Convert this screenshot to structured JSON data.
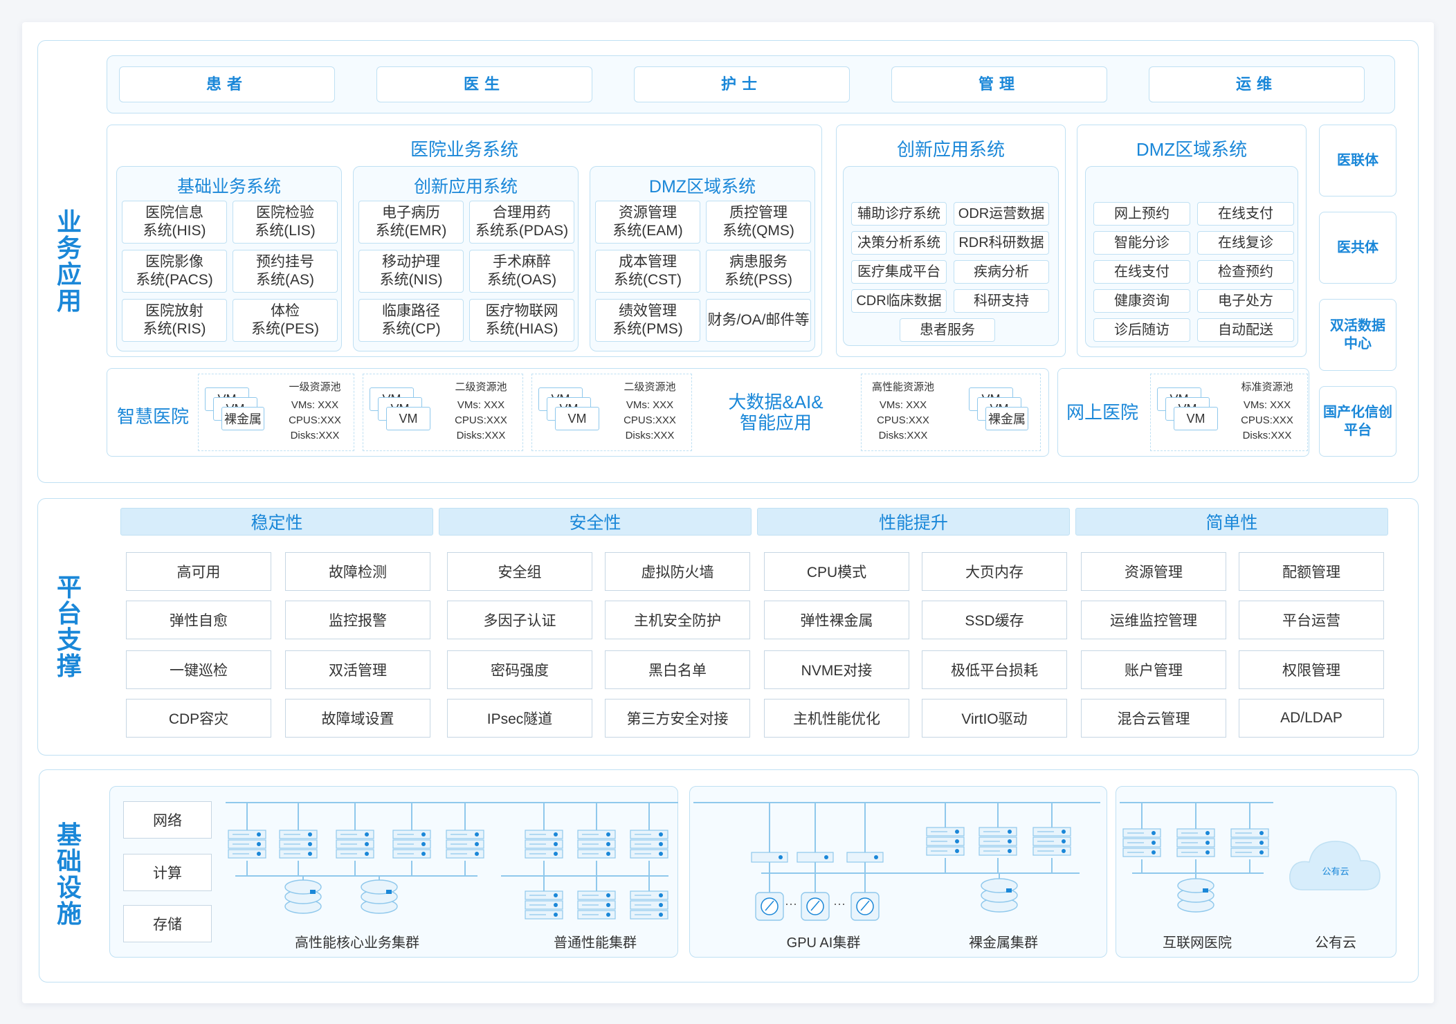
{
  "layers": {
    "business": "业务应用",
    "platform": "平台支撑",
    "infra": "基础设施"
  },
  "roles": [
    "患者",
    "医生",
    "护士",
    "管理",
    "运维"
  ],
  "hospital": {
    "title": "医院业务系统",
    "groups": [
      {
        "title": "基础业务系统",
        "items": [
          "医院信息\n系统(HIS)",
          "医院检验\n系统(LIS)",
          "医院影像\n系统(PACS)",
          "预约挂号\n系统(AS)",
          "医院放射\n系统(RIS)",
          "体检\n系统(PES)"
        ]
      },
      {
        "title": "创新应用系统",
        "items": [
          "电子病历\n系统(EMR)",
          "合理用药\n系统系(PDAS)",
          "移动护理\n系统(NIS)",
          "手术麻醉\n系统(OAS)",
          "临康路径\n系统(CP)",
          "医疗物联网\n系统(HIAS)"
        ]
      },
      {
        "title": "DMZ区域系统",
        "items": [
          "资源管理\n系统(EAM)",
          "质控管理\n系统(QMS)",
          "成本管理\n系统(CST)",
          "病患服务\n系统(PSS)",
          "绩效管理\n系统(PMS)",
          "财务/OA/邮件等"
        ]
      }
    ]
  },
  "innovation": {
    "title": "创新应用系统",
    "items": [
      "辅助诊疗系统",
      "ODR运营数据",
      "决策分析系统",
      "RDR科研数据",
      "医疗集成平台",
      "疾病分析",
      "CDR临床数据",
      "科研支持",
      "患者服务"
    ]
  },
  "dmz": {
    "title": "DMZ区域系统",
    "items": [
      "网上预约",
      "在线支付",
      "智能分诊",
      "在线复诊",
      "在线支付",
      "检查预约",
      "健康资询",
      "电子处方",
      "诊后随访",
      "自动配送"
    ]
  },
  "side": [
    "医联体",
    "医共体",
    "双活数据\n中心",
    "国产化信创\n平台"
  ],
  "smart": {
    "label": "智慧医院",
    "bigdata": "大数据&AI&\n智能应用",
    "online": "网上医院",
    "vm": "VM",
    "baremetal": "裸金属",
    "pools": [
      {
        "name": "一级资源池",
        "vms": "VMs: XXX",
        "cpus": "CPUS:XXX",
        "disks": "Disks:XXX"
      },
      {
        "name": "二级资源池",
        "vms": "VMs: XXX",
        "cpus": "CPUS:XXX",
        "disks": "Disks:XXX"
      },
      {
        "name": "二级资源池",
        "vms": "VMs: XXX",
        "cpus": "CPUS:XXX",
        "disks": "Disks:XXX"
      },
      {
        "name": "高性能资源池",
        "vms": "VMs: XXX",
        "cpus": "CPUS:XXX",
        "disks": "Disks:XXX"
      },
      {
        "name": "标准资源池",
        "vms": "VMs: XXX",
        "cpus": "CPUS:XXX",
        "disks": "Disks:XXX"
      }
    ]
  },
  "platform": {
    "pillars": [
      "稳定性",
      "安全性",
      "性能提升",
      "简单性"
    ],
    "columns": [
      [
        "高可用",
        "弹性自愈",
        "一键巡检",
        "CDP容灾"
      ],
      [
        "故障检测",
        "监控报警",
        "双活管理",
        "故障域设置"
      ],
      [
        "安全组",
        "多因子认证",
        "密码强度",
        "IPsec隧道"
      ],
      [
        "虚拟防火墙",
        "主机安全防护",
        "黑白名单",
        "第三方安全对接"
      ],
      [
        "CPU模式",
        "弹性裸金属",
        "NVME对接",
        "主机性能优化"
      ],
      [
        "大页内存",
        "SSD缓存",
        "极低平台损耗",
        "VirtIO驱动"
      ],
      [
        "资源管理",
        "运维监控管理",
        "账户管理",
        "混合云管理"
      ],
      [
        "配额管理",
        "平台运营",
        "权限管理",
        "AD/LDAP"
      ]
    ]
  },
  "infra": {
    "types": [
      "网络",
      "计算",
      "存储"
    ],
    "clusters": [
      "高性能核心业务集群",
      "普通性能集群",
      "GPU AI集群",
      "裸金属集群",
      "互联网医院",
      "公有云"
    ],
    "cloud": "公有云",
    "dots": "···"
  },
  "colors": {
    "accent": "#1a87d8",
    "border": "#bfe0f3",
    "fill": "#d7edfb"
  }
}
